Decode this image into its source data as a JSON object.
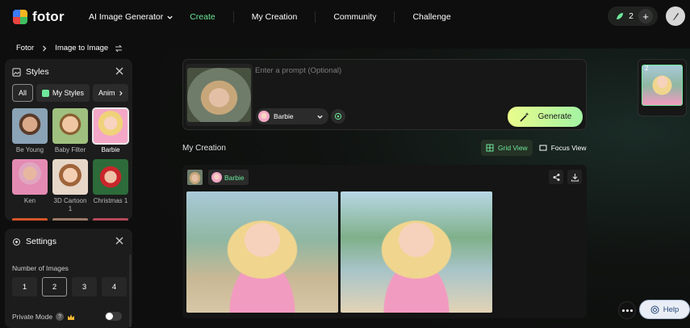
{
  "app": {
    "name": "fotor"
  },
  "nav": {
    "ai_image_generator": "AI Image Generator",
    "create": "Create",
    "my_creation": "My Creation",
    "community": "Community",
    "challenge": "Challenge"
  },
  "account": {
    "credits": "2",
    "plus_icon": "+"
  },
  "breadcrumb": {
    "root": "Fotor",
    "current": "Image to Image"
  },
  "styles_panel": {
    "title": "Styles",
    "tabs": [
      "All",
      "My Styles",
      "Anim"
    ],
    "items": [
      {
        "label": "Be Young",
        "selected": false
      },
      {
        "label": "Baby Filter",
        "selected": false
      },
      {
        "label": "Barbie",
        "selected": true
      },
      {
        "label": "Ken",
        "selected": false
      },
      {
        "label": "3D Cartoon 1",
        "selected": false
      },
      {
        "label": "Christmas 1",
        "selected": false
      }
    ]
  },
  "settings_panel": {
    "title": "Settings",
    "number_label": "Number of Images",
    "numbers": [
      "1",
      "2",
      "3",
      "4"
    ],
    "selected_number": "2",
    "private_mode_label": "Private Mode",
    "private_mode_on": false
  },
  "prompt": {
    "placeholder": "Enter a prompt (Optional)",
    "style_chip": "Barbie",
    "generate_label": "Generate"
  },
  "creation": {
    "title": "My Creation",
    "grid_view": "Grid View",
    "focus_view": "Focus View",
    "style_tag": "Barbie"
  },
  "right_rail": {
    "count": "2"
  },
  "help": {
    "label": "Help"
  },
  "colors": {
    "accent": "#6ee79a",
    "generate_start": "#eafc8c",
    "generate_end": "#a3f3a3",
    "background": "#0d0e0d"
  },
  "icons": [
    "chevron-down-icon",
    "leaf-icon",
    "plus-icon",
    "quill-icon",
    "chevron-right-icon",
    "swap-icon",
    "styles-icon",
    "close-icon",
    "settings-icon",
    "question-icon",
    "crown-icon",
    "magic-wand-icon",
    "grid-icon",
    "focus-icon",
    "download-icon",
    "share-icon",
    "help-icon"
  ]
}
